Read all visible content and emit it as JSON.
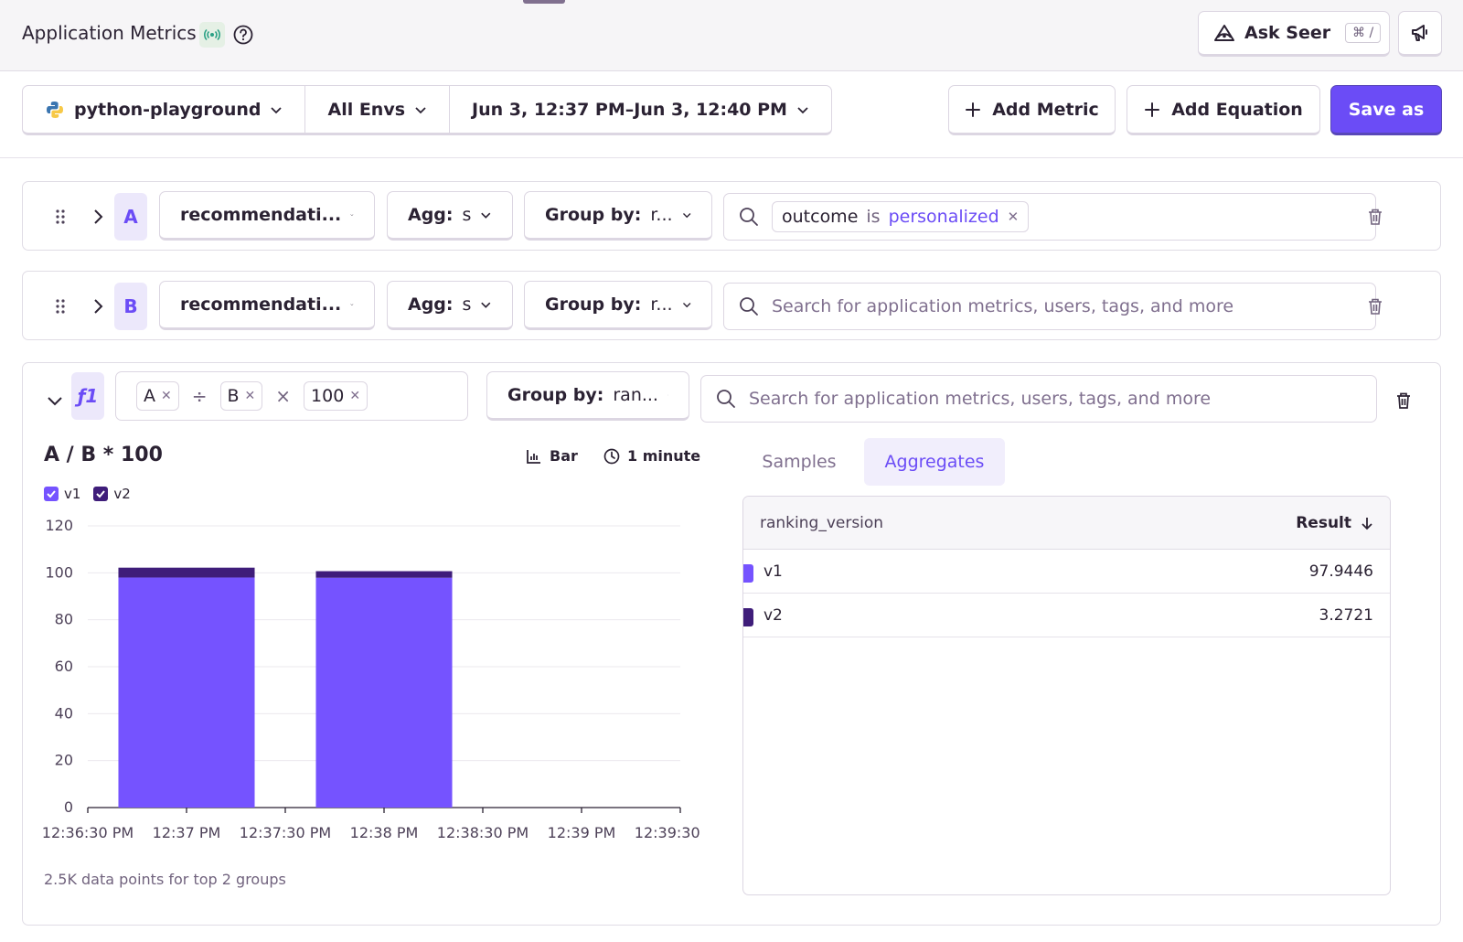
{
  "header": {
    "title": "Application Metrics",
    "ask_seer_label": "Ask Seer",
    "ask_seer_shortcut": "⌘ /"
  },
  "filters": {
    "project": "python-playground",
    "environment": "All Envs",
    "date_range": "Jun 3, 12:37 PM–Jun 3, 12:40 PM"
  },
  "actions": {
    "add_metric": "Add Metric",
    "add_equation": "Add Equation",
    "save_as": "Save as"
  },
  "metrics": [
    {
      "letter": "A",
      "metric": "recommendati...",
      "agg_label": "Agg:",
      "agg_value": "s",
      "group_label": "Group by:",
      "group_value": "r...",
      "filter_key": "outcome",
      "filter_op": "is",
      "filter_value": "personalized"
    },
    {
      "letter": "B",
      "metric": "recommendati...",
      "agg_label": "Agg:",
      "agg_value": "s",
      "group_label": "Group by:",
      "group_value": "r...",
      "search_placeholder": "Search for application metrics, users, tags, and more"
    }
  ],
  "equation": {
    "tag": "ƒ1",
    "tokens": [
      "A",
      "÷",
      "B",
      "×",
      "100"
    ],
    "group_label": "Group by:",
    "group_value": "ran...",
    "search_placeholder": "Search for application metrics, users, tags, and more"
  },
  "chart_controls": {
    "type_label": "Bar",
    "interval_label": "1 minute"
  },
  "chart_footnote": "2.5K data points for top 2 groups",
  "chart_data": {
    "type": "bar",
    "stacked": true,
    "title": "A / B * 100",
    "xlabel": "",
    "ylabel": "",
    "ylim": [
      0,
      120
    ],
    "yticks": [
      0,
      20,
      40,
      60,
      80,
      100,
      120
    ],
    "xticks": [
      "12:36:30 PM",
      "12:37 PM",
      "12:37:30 PM",
      "12:38 PM",
      "12:38:30 PM",
      "12:39 PM",
      "12:39:30 PM"
    ],
    "categories": [
      "12:37 PM",
      "12:38 PM"
    ],
    "series": [
      {
        "name": "v1",
        "color": "#7553ff",
        "values": [
          98.0,
          97.9
        ]
      },
      {
        "name": "v2",
        "color": "#3f1d7a",
        "values": [
          4.2,
          2.8
        ]
      }
    ],
    "grid": true,
    "legend": "top-left"
  },
  "results_panel": {
    "tabs": [
      "Samples",
      "Aggregates"
    ],
    "active_tab": "Aggregates",
    "columns": [
      "ranking_version",
      "Result"
    ],
    "rows": [
      {
        "group": "v1",
        "result": "97.9446",
        "color": "#7553ff"
      },
      {
        "group": "v2",
        "result": "3.2721",
        "color": "#3f1d7a"
      }
    ]
  }
}
